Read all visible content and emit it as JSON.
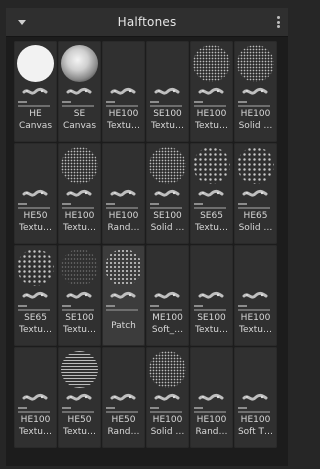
{
  "panel": {
    "title": "Halftones"
  },
  "tiles": [
    {
      "line1": "HE",
      "line2": "Canvas",
      "thumb": "solid"
    },
    {
      "line1": "SE",
      "line2": "Canvas",
      "thumb": "soft"
    },
    {
      "line1": "HE100",
      "line2": "Textu…",
      "thumb": "none"
    },
    {
      "line1": "SE100",
      "line2": "Textu…",
      "thumb": "none"
    },
    {
      "line1": "HE100",
      "line2": "Textu…",
      "thumb": "dots"
    },
    {
      "line1": "HE100",
      "line2": "Solid …",
      "thumb": "dots"
    },
    {
      "line1": "HE50",
      "line2": "Textu…",
      "thumb": "none"
    },
    {
      "line1": "HE100",
      "line2": "Textu…",
      "thumb": "dots"
    },
    {
      "line1": "HE100",
      "line2": "Rand…",
      "thumb": "none"
    },
    {
      "line1": "SE100",
      "line2": "Solid …",
      "thumb": "dots"
    },
    {
      "line1": "SE65",
      "line2": "Textu…",
      "thumb": "dots-sparse"
    },
    {
      "line1": "HE65",
      "line2": "Solid …",
      "thumb": "dots-sparse"
    },
    {
      "line1": "SE65",
      "line2": "Textu…",
      "thumb": "dots-sparse"
    },
    {
      "line1": "SE100",
      "line2": "Textu…",
      "thumb": "grain"
    },
    {
      "line1": "Patch",
      "line2": "",
      "thumb": "bigdots",
      "selected": true
    },
    {
      "line1": "ME100",
      "line2": "Soft_…",
      "thumb": "none"
    },
    {
      "line1": "SE100",
      "line2": "Textu…",
      "thumb": "none"
    },
    {
      "line1": "HE100",
      "line2": "Textu…",
      "thumb": "none"
    },
    {
      "line1": "HE100",
      "line2": "Textu…",
      "thumb": "none"
    },
    {
      "line1": "HE50",
      "line2": "Textu…",
      "thumb": "lines"
    },
    {
      "line1": "HE50",
      "line2": "Rand…",
      "thumb": "none"
    },
    {
      "line1": "HE100",
      "line2": "Solid …",
      "thumb": "dots"
    },
    {
      "line1": "HE100",
      "line2": "Rand…",
      "thumb": "none"
    },
    {
      "line1": "HE100",
      "line2": "Soft T…",
      "thumb": "none"
    }
  ]
}
